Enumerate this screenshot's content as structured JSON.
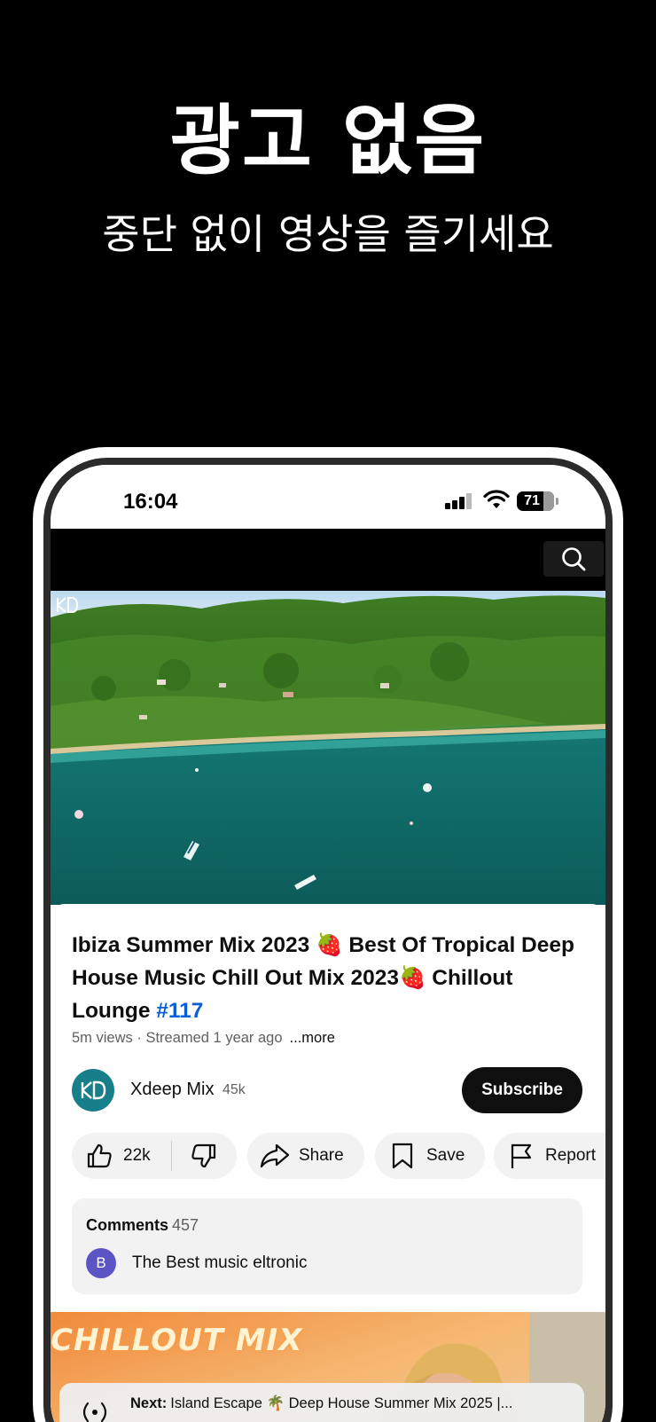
{
  "promo": {
    "title": "광고 없음",
    "subtitle": "중단 없이 영상을 즐기세요"
  },
  "status_bar": {
    "time": "16:04",
    "battery": "71"
  },
  "top_bar": {
    "search_icon": "search-icon"
  },
  "video": {
    "title_main": "Ibiza Summer Mix 2023 🍓 Best Of Tropical Deep House Music Chill Out Mix 2023🍓 Chillout Lounge ",
    "hashtag": "#117",
    "views": "5m views",
    "separator": " · ",
    "streamed": "Streamed 1 year ago",
    "more": "...more"
  },
  "channel": {
    "name": "Xdeep Mix",
    "subscribers": "45k",
    "subscribe_label": "Subscribe"
  },
  "actions": {
    "likes": "22k",
    "share": "Share",
    "save": "Save",
    "report": "Report"
  },
  "comments": {
    "heading": "Comments",
    "count": "457",
    "avatar_letter": "B",
    "top_comment": "The Best music eltronic"
  },
  "next_up": {
    "preview_title": "CHILLOUT MIX",
    "label": "Next:",
    "title": "Island Escape 🌴 Deep House Summer Mix 2025 |..."
  },
  "colors": {
    "background": "#000000",
    "subscribe_bg": "#0f0f0f",
    "hashtag": "#065fd4",
    "chip_bg": "#f2f2f2",
    "avatar_bg": "#167f8a",
    "commenter_avatar_bg": "#5c54c4"
  }
}
